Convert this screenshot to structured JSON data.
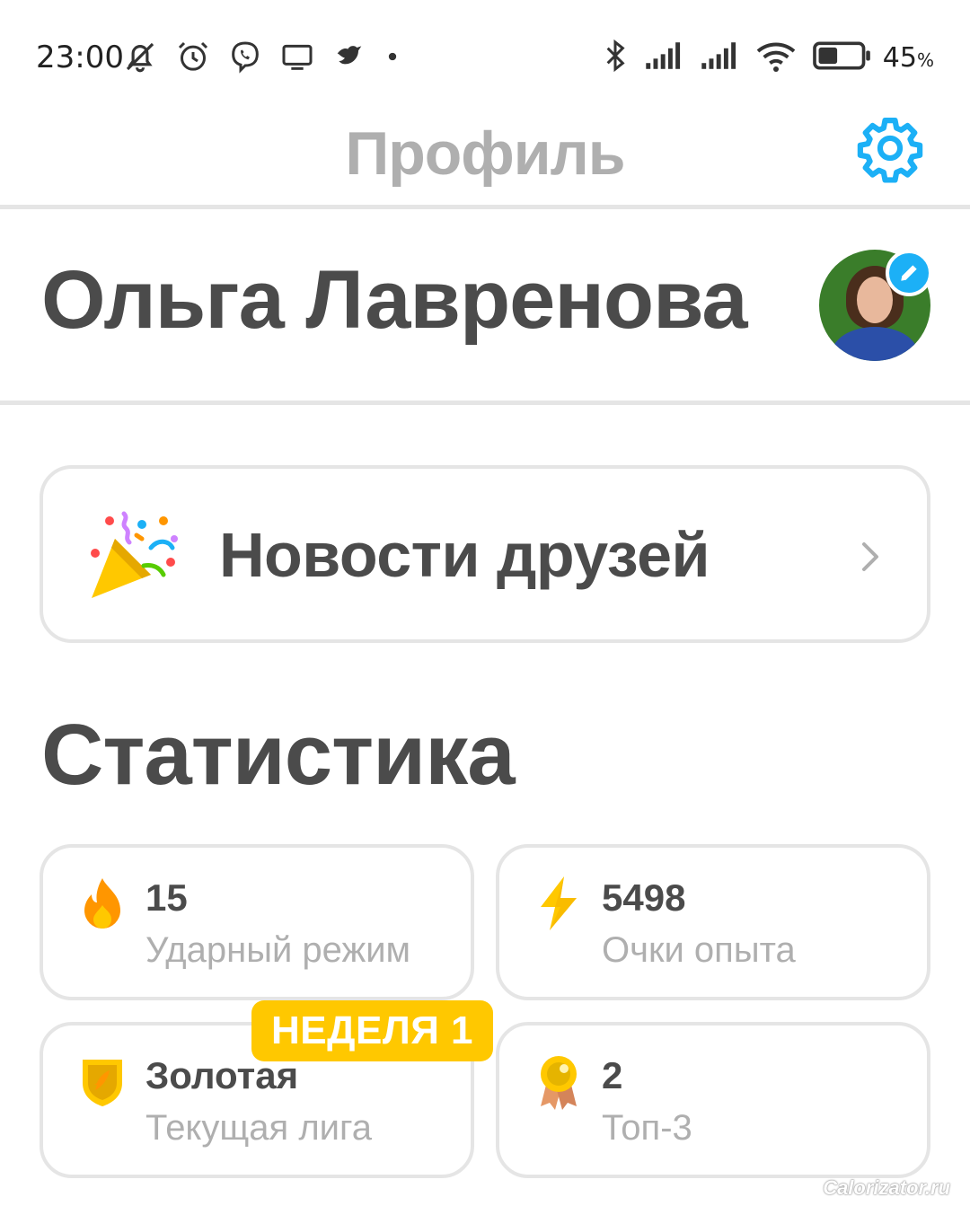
{
  "status_bar": {
    "time": "23:00",
    "left_icons": [
      "muted-bell-icon",
      "alarm-icon",
      "viber-icon",
      "cast-icon",
      "bird-icon",
      "dot-icon"
    ],
    "right_icons": [
      "bluetooth-icon",
      "signal-icon",
      "signal-icon",
      "wifi-icon",
      "battery-icon"
    ],
    "battery_percent": "45",
    "battery_unit": "%",
    "battery_level": 0.45
  },
  "header": {
    "title": "Профиль",
    "settings_icon": "gear-icon",
    "accent_color": "#1cb0f6"
  },
  "profile": {
    "name": "Ольга Лавренова",
    "avatar_edit_icon": "pencil-icon"
  },
  "friends_news": {
    "label": "Новости друзей",
    "icon": "party-popper-icon",
    "chevron_icon": "chevron-right-icon"
  },
  "statistics": {
    "title": "Статистика",
    "cards": [
      {
        "icon": "fire-icon",
        "value": "15",
        "label": "Ударный режим",
        "icon_color": "#ff9600"
      },
      {
        "icon": "lightning-icon",
        "value": "5498",
        "label": "Очки опыта",
        "icon_color": "#ffc800"
      },
      {
        "icon": "gold-shield-icon",
        "value": "Золотая",
        "label": "Текущая лига",
        "icon_color": "#ffc800"
      },
      {
        "icon": "medal-icon",
        "value": "2",
        "label": "Топ-3",
        "icon_color": "#ffc800"
      }
    ],
    "week_badge": "НЕДЕЛЯ 1"
  },
  "watermark": "Calorizator.ru"
}
